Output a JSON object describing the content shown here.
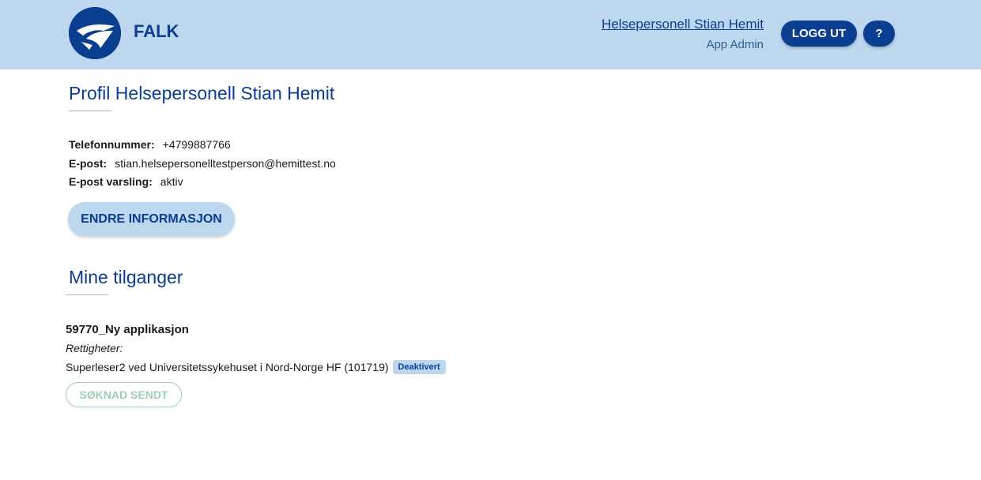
{
  "header": {
    "brand": "FALK",
    "user_name": "Helsepersonell Stian Hemit",
    "user_role": "App Admin",
    "logout_label": "LOGG UT",
    "help_label": "?",
    "background": "#bdd8ee",
    "accent": "#0b3d91",
    "logo_icon": "falcon-logo-icon"
  },
  "profile": {
    "title": "Profil Helsepersonell Stian Hemit",
    "phone_label": "Telefonnummer:",
    "phone_value": "+4799887766",
    "email_label": "E-post:",
    "email_value": "stian.helsepersonelltestperson@hemittest.no",
    "notify_label": "E-post varsling:",
    "notify_value": "aktiv",
    "edit_button": "ENDRE INFORMASJON"
  },
  "access": {
    "title": "Mine tilganger",
    "items": [
      {
        "app_name": "59770_Ny applikasjon",
        "rights_label": "Rettigheter:",
        "right": "Superleser2 ved Universitetssykehuset i Nord-Norge HF (101719)",
        "badge": "Deaktivert",
        "status_button": "SØKNAD SENDT"
      }
    ]
  }
}
